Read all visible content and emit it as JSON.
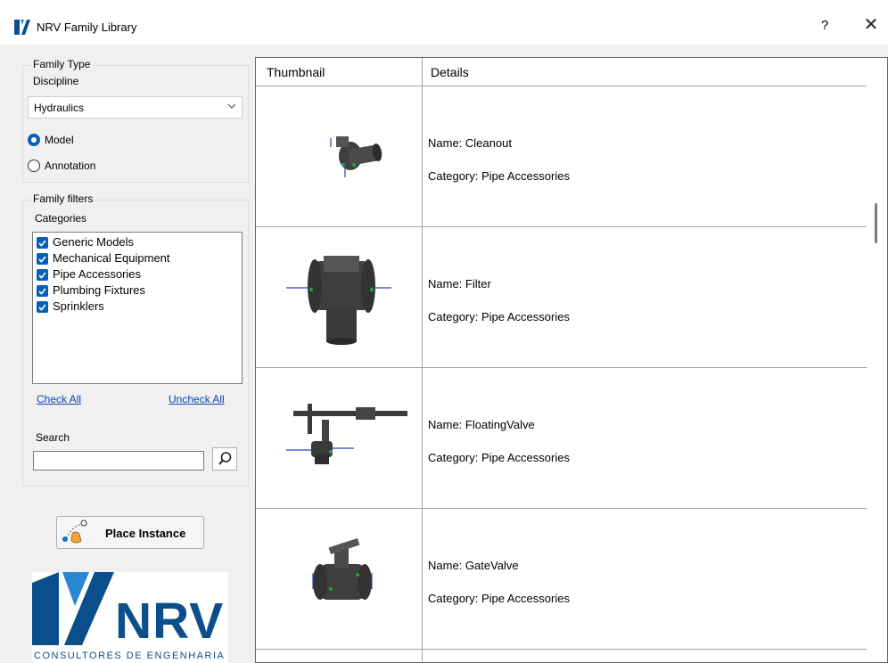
{
  "window": {
    "title": "NRV Family Library",
    "help_label": "?",
    "close_label": "✕"
  },
  "family_type": {
    "group_title": "Family Type",
    "discipline_label": "Discipline",
    "discipline_value": "Hydraulics",
    "radio_model": "Model",
    "radio_annotation": "Annotation",
    "selected": "Model"
  },
  "family_filters": {
    "group_title": "Family filters",
    "categories_label": "Categories",
    "categories": [
      {
        "label": "Generic Models",
        "checked": true
      },
      {
        "label": "Mechanical Equipment",
        "checked": true
      },
      {
        "label": "Pipe Accessories",
        "checked": true
      },
      {
        "label": "Plumbing Fixtures",
        "checked": true
      },
      {
        "label": "Sprinklers",
        "checked": true
      }
    ],
    "check_all": "Check All",
    "uncheck_all": "Uncheck All",
    "search_label": "Search",
    "search_value": ""
  },
  "place_instance_label": "Place Instance",
  "logo": {
    "name": "NRV",
    "subtitle": "CONSULTORES DE ENGENHARIA"
  },
  "grid": {
    "col_thumbnail": "Thumbnail",
    "col_details": "Details",
    "rows": [
      {
        "name": "Name: Cleanout",
        "category": "Category: Pipe Accessories",
        "thumb_icon": "cleanout-thumbnail"
      },
      {
        "name": "Name: Filter",
        "category": "Category: Pipe Accessories",
        "thumb_icon": "filter-thumbnail"
      },
      {
        "name": "Name: FloatingValve",
        "category": "Category: Pipe Accessories",
        "thumb_icon": "floating-valve-thumbnail"
      },
      {
        "name": "Name: GateValve",
        "category": "Category: Pipe Accessories",
        "thumb_icon": "gate-valve-thumbnail"
      }
    ]
  },
  "colors": {
    "accent_blue": "#0a60b8",
    "logo_blue": "#0a4f8c",
    "link_blue": "#0645ad"
  }
}
